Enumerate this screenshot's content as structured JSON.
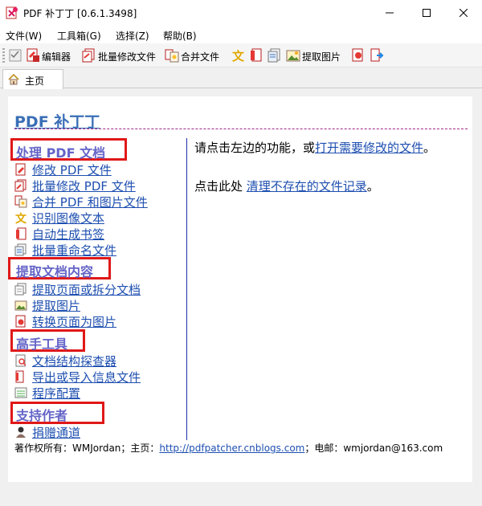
{
  "window": {
    "title": "PDF 补丁丁 [0.6.1.3498]"
  },
  "menu": {
    "items": [
      "文件(W)",
      "工具箱(G)",
      "选择(Z)",
      "帮助(B)"
    ]
  },
  "toolbar": {
    "editor_label": "编辑器",
    "batch_modify_label": "批量修改文件",
    "merge_label": "合并文件",
    "extract_images_label": "提取图片"
  },
  "tab": {
    "label": "主页"
  },
  "home": {
    "title": "PDF 补丁丁",
    "sections": [
      {
        "heading": "处理 PDF 文档",
        "links": [
          "修改 PDF 文件",
          "批量修改 PDF 文件",
          "合并 PDF 和图片文件",
          "识别图像文本",
          "自动生成书签",
          "批量重命名文件"
        ]
      },
      {
        "heading": "提取文档内容",
        "links": [
          "提取页面或拆分文档",
          "提取图片",
          "转换页面为图片"
        ]
      },
      {
        "heading": "高手工具",
        "links": [
          "文档结构探查器",
          "导出或导入信息文件",
          "程序配置"
        ]
      },
      {
        "heading": "支持作者",
        "links": [
          "捐赠通道"
        ]
      }
    ],
    "instruction_prefix": "请点击左边的功能，或",
    "instruction_link": "打开需要修改的文件",
    "instruction_suffix": "。",
    "cleanup_prefix": "点击此处 ",
    "cleanup_link": "清理不存在的文件记录",
    "cleanup_suffix": "。",
    "footer_prefix": "著作权所有：WMJordan；主页：",
    "footer_link": "http://pdfpatcher.cnblogs.com",
    "footer_suffix": "；电邮：wmjordan@163.com"
  },
  "colors": {
    "link": "#1e4fb0",
    "section_heading": "#6464c8",
    "title": "#3a6fb6",
    "highlight_box": "#e01818",
    "separator": "#1c2ea8"
  }
}
